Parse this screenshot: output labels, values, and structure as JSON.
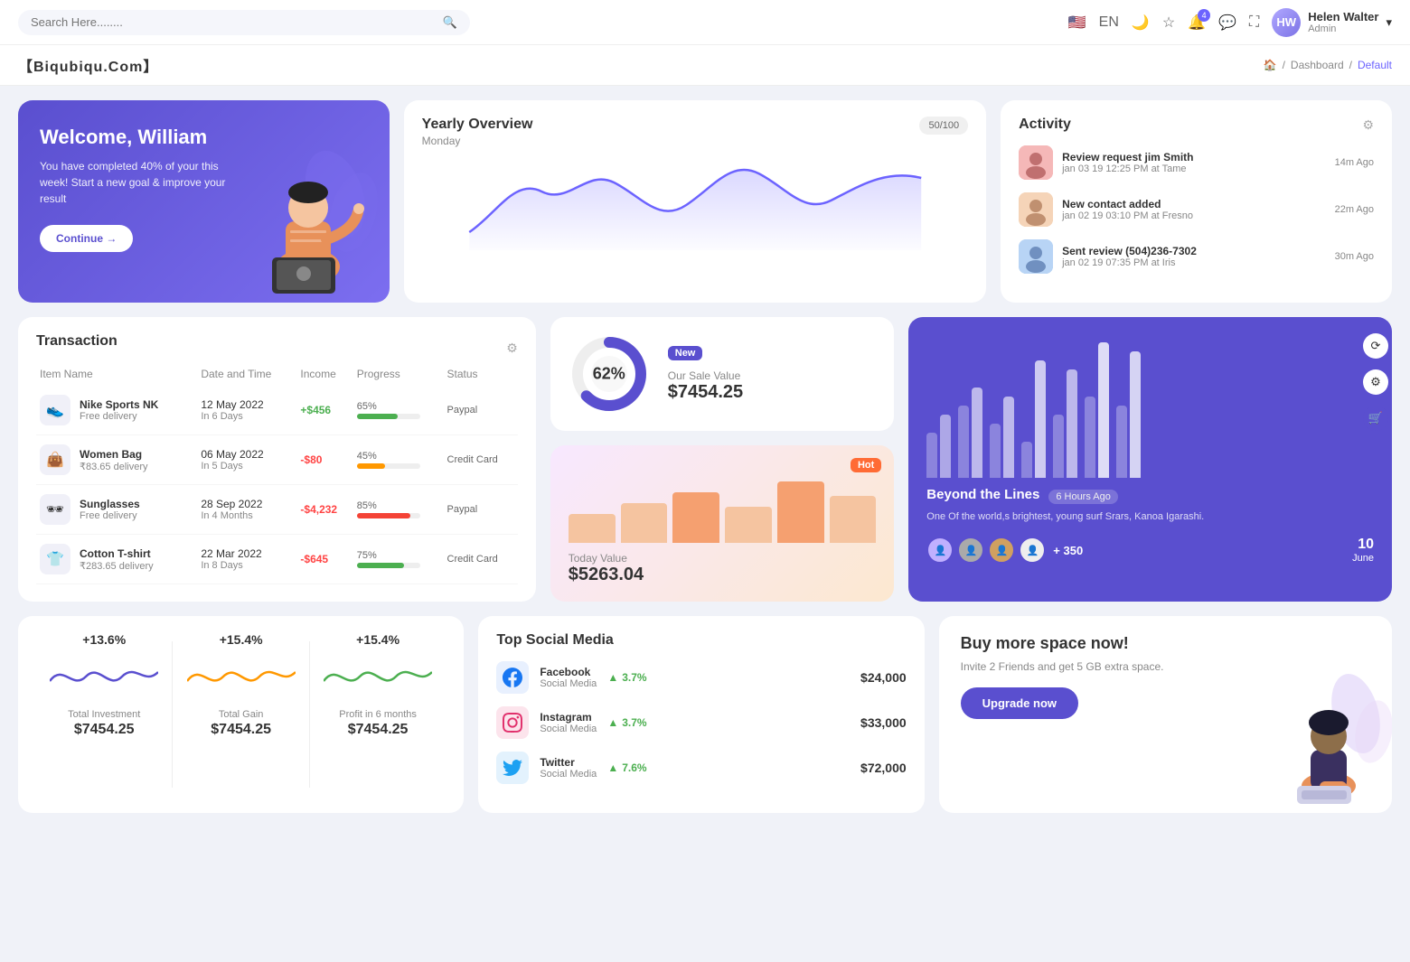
{
  "navbar": {
    "search_placeholder": "Search Here........",
    "lang": "EN",
    "notification_count": "4",
    "user": {
      "name": "Helen Walter",
      "role": "Admin",
      "initials": "HW"
    }
  },
  "breadcrumb": {
    "brand": "【Biqubiqu.Com】",
    "home": "🏠",
    "items": [
      "Dashboard",
      "Default"
    ]
  },
  "welcome": {
    "title": "Welcome, William",
    "subtitle": "You have completed 40% of your this week! Start a new goal & improve your result",
    "button": "Continue →"
  },
  "yearly": {
    "title": "Yearly Overview",
    "subtitle": "Monday",
    "badge": "50/100"
  },
  "activity": {
    "title": "Activity",
    "items": [
      {
        "title": "Review request jim Smith",
        "subtitle": "jan 03 19 12:25 PM at Tame",
        "time": "14m Ago"
      },
      {
        "title": "New contact added",
        "subtitle": "jan 02 19 03:10 PM at Fresno",
        "time": "22m Ago"
      },
      {
        "title": "Sent review (504)236-7302",
        "subtitle": "jan 02 19 07:35 PM at Iris",
        "time": "30m Ago"
      }
    ]
  },
  "transaction": {
    "title": "Transaction",
    "headers": [
      "Item Name",
      "Date and Time",
      "Income",
      "Progress",
      "Status"
    ],
    "rows": [
      {
        "icon": "👟",
        "name": "Nike Sports NK",
        "sub": "Free delivery",
        "date": "12 May 2022",
        "date_sub": "In 6 Days",
        "income": "+$456",
        "income_type": "pos",
        "progress": 65,
        "progress_color": "#4caf50",
        "status": "Paypal"
      },
      {
        "icon": "👜",
        "name": "Women Bag",
        "sub": "₹83.65 delivery",
        "date": "06 May 2022",
        "date_sub": "In 5 Days",
        "income": "-$80",
        "income_type": "neg",
        "progress": 45,
        "progress_color": "#ff9800",
        "status": "Credit Card"
      },
      {
        "icon": "🕶",
        "name": "Sunglasses",
        "sub": "Free delivery",
        "date": "28 Sep 2022",
        "date_sub": "In 4 Months",
        "income": "-$4,232",
        "income_type": "neg",
        "progress": 85,
        "progress_color": "#f44336",
        "status": "Paypal"
      },
      {
        "icon": "👕",
        "name": "Cotton T-shirt",
        "sub": "₹283.65 delivery",
        "date": "22 Mar 2022",
        "date_sub": "In 8 Days",
        "income": "-$645",
        "income_type": "neg",
        "progress": 75,
        "progress_color": "#4caf50",
        "status": "Credit Card"
      }
    ]
  },
  "sale": {
    "badge": "New",
    "percentage": "62%",
    "label": "Our Sale Value",
    "value": "$7454.25"
  },
  "today": {
    "badge": "Hot",
    "label": "Today Value",
    "value": "$5263.04"
  },
  "beyond": {
    "title": "Beyond the Lines",
    "time": "6 Hours Ago",
    "desc": "One Of the world,s brightest, young surf Srars, Kanoa Igarashi.",
    "plus": "+ 350",
    "date": "10",
    "month": "June"
  },
  "stats": [
    {
      "pct": "+13.6%",
      "label": "Total Investment",
      "value": "$7454.25",
      "color": "#5a4fcf"
    },
    {
      "pct": "+15.4%",
      "label": "Total Gain",
      "value": "$7454.25",
      "color": "#ff9800"
    },
    {
      "pct": "+15.4%",
      "label": "Profit in 6 months",
      "value": "$7454.25",
      "color": "#4caf50"
    }
  ],
  "social": {
    "title": "Top Social Media",
    "items": [
      {
        "name": "Facebook",
        "sub": "Social Media",
        "growth": "3.7%",
        "amount": "$24,000",
        "color": "#1877F2",
        "icon": "f"
      },
      {
        "name": "Instagram",
        "sub": "Social Media",
        "growth": "3.7%",
        "amount": "$33,000",
        "color": "#E1306C",
        "icon": "📷"
      },
      {
        "name": "Twitter",
        "sub": "Social Media",
        "growth": "7.6%",
        "amount": "$72,000",
        "color": "#1DA1F2",
        "icon": "t"
      }
    ]
  },
  "buy": {
    "title": "Buy more space now!",
    "desc": "Invite 2 Friends and get 5 GB extra space.",
    "button": "Upgrade now"
  }
}
